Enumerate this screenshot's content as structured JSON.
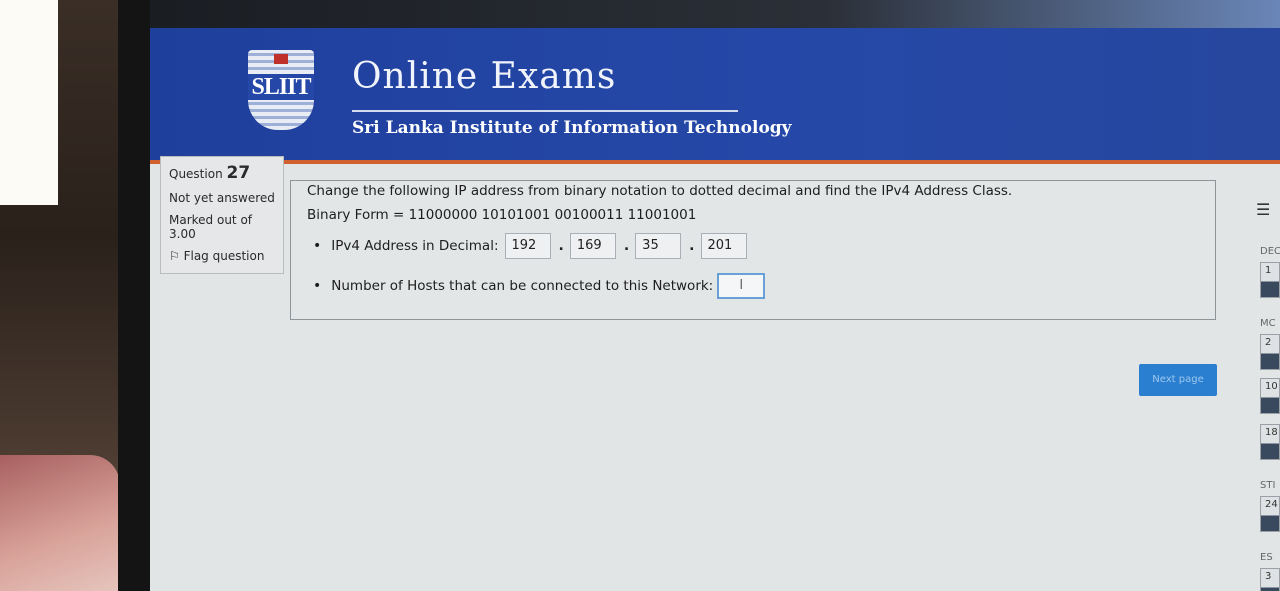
{
  "header": {
    "title": "Online Exams",
    "subtitle": "Sri Lanka Institute of Information Technology",
    "logo_text": "SLIIT"
  },
  "question_info": {
    "question_label": "Question",
    "question_number": "27",
    "status": "Not yet answered",
    "marked_label": "Marked out of",
    "marked_value": "3.00",
    "flag_label": "Flag question"
  },
  "question": {
    "text": "Change the following IP address from binary notation to dotted decimal and find the IPv4 Address Class.",
    "binary": "Binary Form = 11000000 10101001 00100011 11001001",
    "ipv4_label": "IPv4 Address in Decimal:",
    "octets": [
      "192",
      "169",
      "35",
      "201"
    ],
    "hosts_label": "Number of Hosts that can be connected to this Network:",
    "hosts_value": ""
  },
  "next_button": "Next page",
  "nav": {
    "menu_icon": "hamburger-icon",
    "sections": [
      {
        "label": "DEC",
        "num": "1"
      },
      {
        "label": "MC",
        "num": "2"
      },
      {
        "label": "",
        "num": "10"
      },
      {
        "label": "",
        "num": "18"
      },
      {
        "label": "STI",
        "num": "24"
      },
      {
        "label": "ES",
        "num": "3"
      }
    ]
  }
}
